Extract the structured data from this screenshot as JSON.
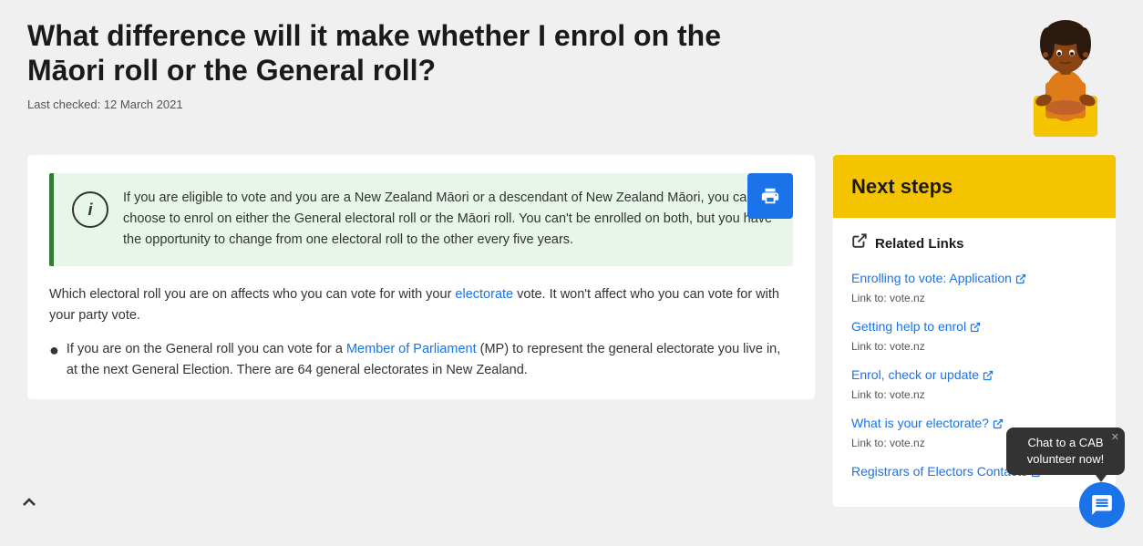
{
  "page": {
    "title": "What difference will it make whether I enrol on the Māori roll or the General roll?",
    "last_checked": "Last checked: 12 March 2021"
  },
  "info_box": {
    "text": "If you are eligible to vote and you are a New Zealand Māori or a descendant of New Zealand Māori, you can choose to enrol on either the General electoral roll or the Māori roll. You can't be enrolled on both, but you have the opportunity to change from one electoral roll to the other every five years."
  },
  "body": {
    "paragraph1": "Which electoral roll you are on affects who you can vote for with your electorate vote. It won't affect who you can vote for with your party vote.",
    "electorate_link": "electorate",
    "bullet1_prefix": "If you are on the General roll you can vote for a ",
    "bullet1_link_text": "Member of Parliament",
    "bullet1_suffix": " (MP) to represent the general electorate you live in, at the next General Election. There are 64 general electorates in New Zealand."
  },
  "sidebar": {
    "next_steps_title": "Next steps",
    "related_links_header": "Related Links",
    "links": [
      {
        "label": "Enrolling to vote: Application",
        "source": "Link to: vote.nz"
      },
      {
        "label": "Getting help to enrol",
        "source": "Link to: vote.nz"
      },
      {
        "label": "Enrol, check or update",
        "source": "Link to: vote.nz"
      },
      {
        "label": "What is your electorate?",
        "source": "Link to: vote.nz"
      },
      {
        "label": "Registrars of Electors Contacts",
        "source": ""
      }
    ]
  },
  "print_button_label": "🖨",
  "scroll_up_label": "∧",
  "chat": {
    "bubble_text": "Chat to a CAB volunteer now!",
    "close_label": "✕"
  },
  "icons": {
    "info": "i",
    "external": "↗",
    "print": "🖨",
    "chat": "💬"
  }
}
